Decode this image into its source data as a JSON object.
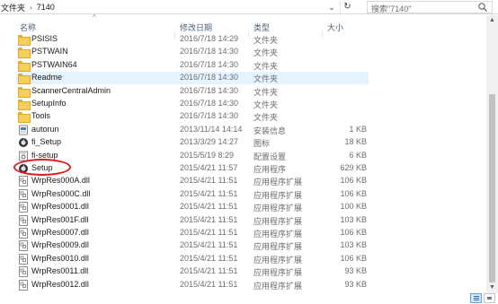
{
  "address": {
    "crumbs": [
      "文件夹",
      "7140"
    ],
    "search_placeholder": "搜索\"7140\""
  },
  "columns": {
    "name": "名称",
    "date": "修改日期",
    "type": "类型",
    "size": "大小"
  },
  "selected_row": "Readme",
  "highlighted_row": "Setup",
  "files": [
    {
      "name": "PSISIS",
      "date": "2016/7/18 14:29",
      "type": "文件夹",
      "size": "",
      "icon": "folder-icon"
    },
    {
      "name": "PSTWAIN",
      "date": "2016/7/18 14:30",
      "type": "文件夹",
      "size": "",
      "icon": "folder-icon"
    },
    {
      "name": "PSTWAIN64",
      "date": "2016/7/18 14:30",
      "type": "文件夹",
      "size": "",
      "icon": "folder-icon"
    },
    {
      "name": "Readme",
      "date": "2016/7/18 14:30",
      "type": "文件夹",
      "size": "",
      "icon": "folder-icon"
    },
    {
      "name": "ScannerCentralAdmin",
      "date": "2016/7/18 14:30",
      "type": "文件夹",
      "size": "",
      "icon": "folder-icon"
    },
    {
      "name": "SetupInfo",
      "date": "2016/7/18 14:30",
      "type": "文件夹",
      "size": "",
      "icon": "folder-icon"
    },
    {
      "name": "Tools",
      "date": "2016/7/18 14:30",
      "type": "文件夹",
      "size": "",
      "icon": "folder-icon"
    },
    {
      "name": "autorun",
      "date": "2013/11/14 14:14",
      "type": "安装信息",
      "size": "1 KB",
      "icon": "setup-info-icon"
    },
    {
      "name": "fi_Setup",
      "date": "2013/3/29 14:27",
      "type": "图标",
      "size": "18 KB",
      "icon": "app-icon"
    },
    {
      "name": "fi-setup",
      "date": "2015/5/19 8:29",
      "type": "配置设置",
      "size": "6 KB",
      "icon": "config-file-icon"
    },
    {
      "name": "Setup",
      "date": "2015/4/21 11:57",
      "type": "应用程序",
      "size": "629 KB",
      "icon": "app-icon"
    },
    {
      "name": "WrpRes000A.dll",
      "date": "2015/4/21 11:51",
      "type": "应用程序扩展",
      "size": "106 KB",
      "icon": "dll-file-icon"
    },
    {
      "name": "WrpRes000C.dll",
      "date": "2015/4/21 11:51",
      "type": "应用程序扩展",
      "size": "106 KB",
      "icon": "dll-file-icon"
    },
    {
      "name": "WrpRes0001.dll",
      "date": "2015/4/21 11:51",
      "type": "应用程序扩展",
      "size": "100 KB",
      "icon": "dll-file-icon"
    },
    {
      "name": "WrpRes001F.dll",
      "date": "2015/4/21 11:51",
      "type": "应用程序扩展",
      "size": "103 KB",
      "icon": "dll-file-icon"
    },
    {
      "name": "WrpRes0007.dll",
      "date": "2015/4/21 11:51",
      "type": "应用程序扩展",
      "size": "106 KB",
      "icon": "dll-file-icon"
    },
    {
      "name": "WrpRes0009.dll",
      "date": "2015/4/21 11:51",
      "type": "应用程序扩展",
      "size": "103 KB",
      "icon": "dll-file-icon"
    },
    {
      "name": "WrpRes0010.dll",
      "date": "2015/4/21 11:51",
      "type": "应用程序扩展",
      "size": "106 KB",
      "icon": "dll-file-icon"
    },
    {
      "name": "WrpRes0011.dll",
      "date": "2015/4/21 11:51",
      "type": "应用程序扩展",
      "size": "93 KB",
      "icon": "dll-file-icon"
    },
    {
      "name": "WrpRes0012.dll",
      "date": "2015/4/21 11:51",
      "type": "应用程序扩展",
      "size": "93 KB",
      "icon": "dll-file-icon"
    }
  ],
  "colors": {
    "selection": "#e5f3ff",
    "highlight_ring": "#d81e1e",
    "header_text": "#4c607a"
  }
}
